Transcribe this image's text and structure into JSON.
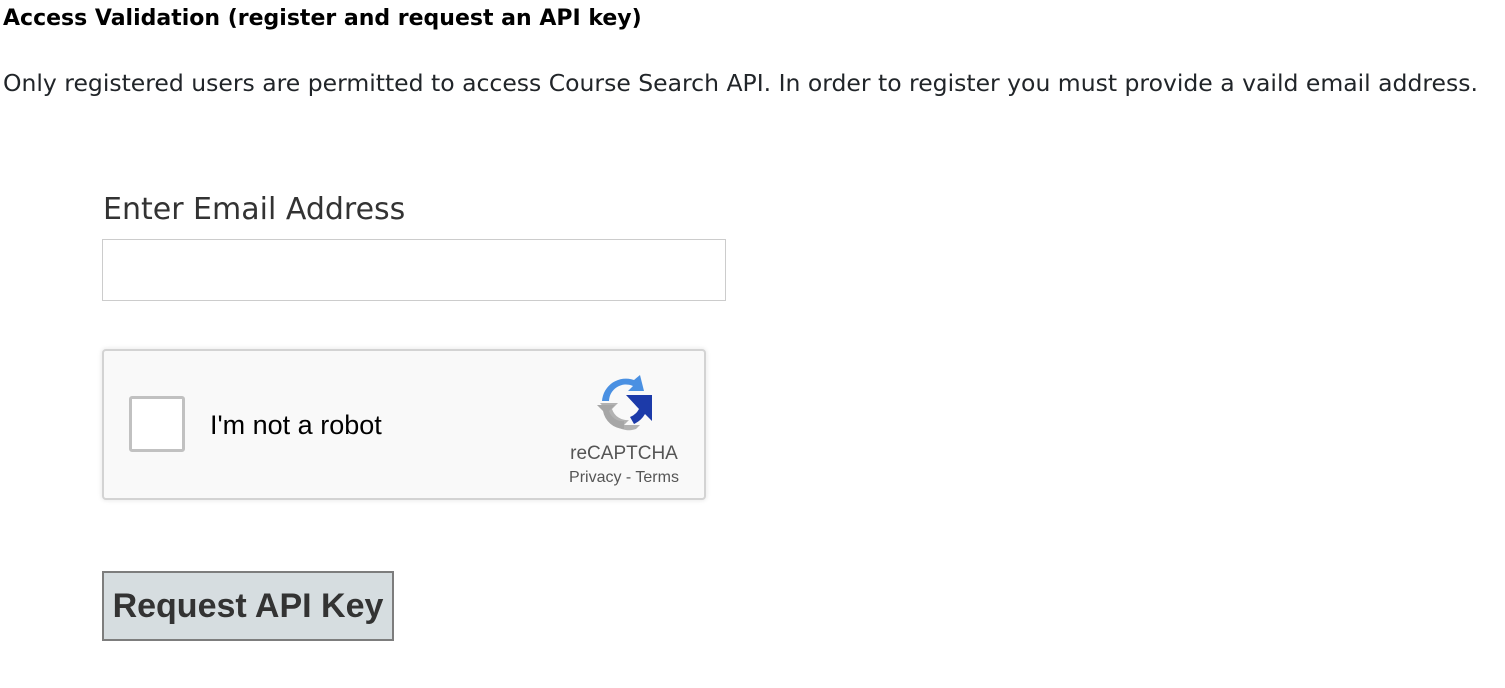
{
  "page": {
    "heading": "Access Validation (register and request an API key)",
    "intro": "Only registered users are permitted to access Course Search API. In order to register you must provide a vaild email address."
  },
  "form": {
    "email_label": "Enter Email Address",
    "email_value": "",
    "submit_label": "Request API Key"
  },
  "recaptcha": {
    "checkbox_label": "I'm not a robot",
    "checked": false,
    "brand": "reCAPTCHA",
    "privacy": "Privacy",
    "separator": "-",
    "terms": "Terms",
    "logo_icon": "recaptcha-logo-icon",
    "colors": {
      "logo_blue_dark": "#1c3aa9",
      "logo_blue_light": "#4a90e2",
      "logo_gray": "#b2b2b2"
    }
  },
  "colors": {
    "button_bg": "#d6dde0",
    "input_border": "#cccccc"
  }
}
